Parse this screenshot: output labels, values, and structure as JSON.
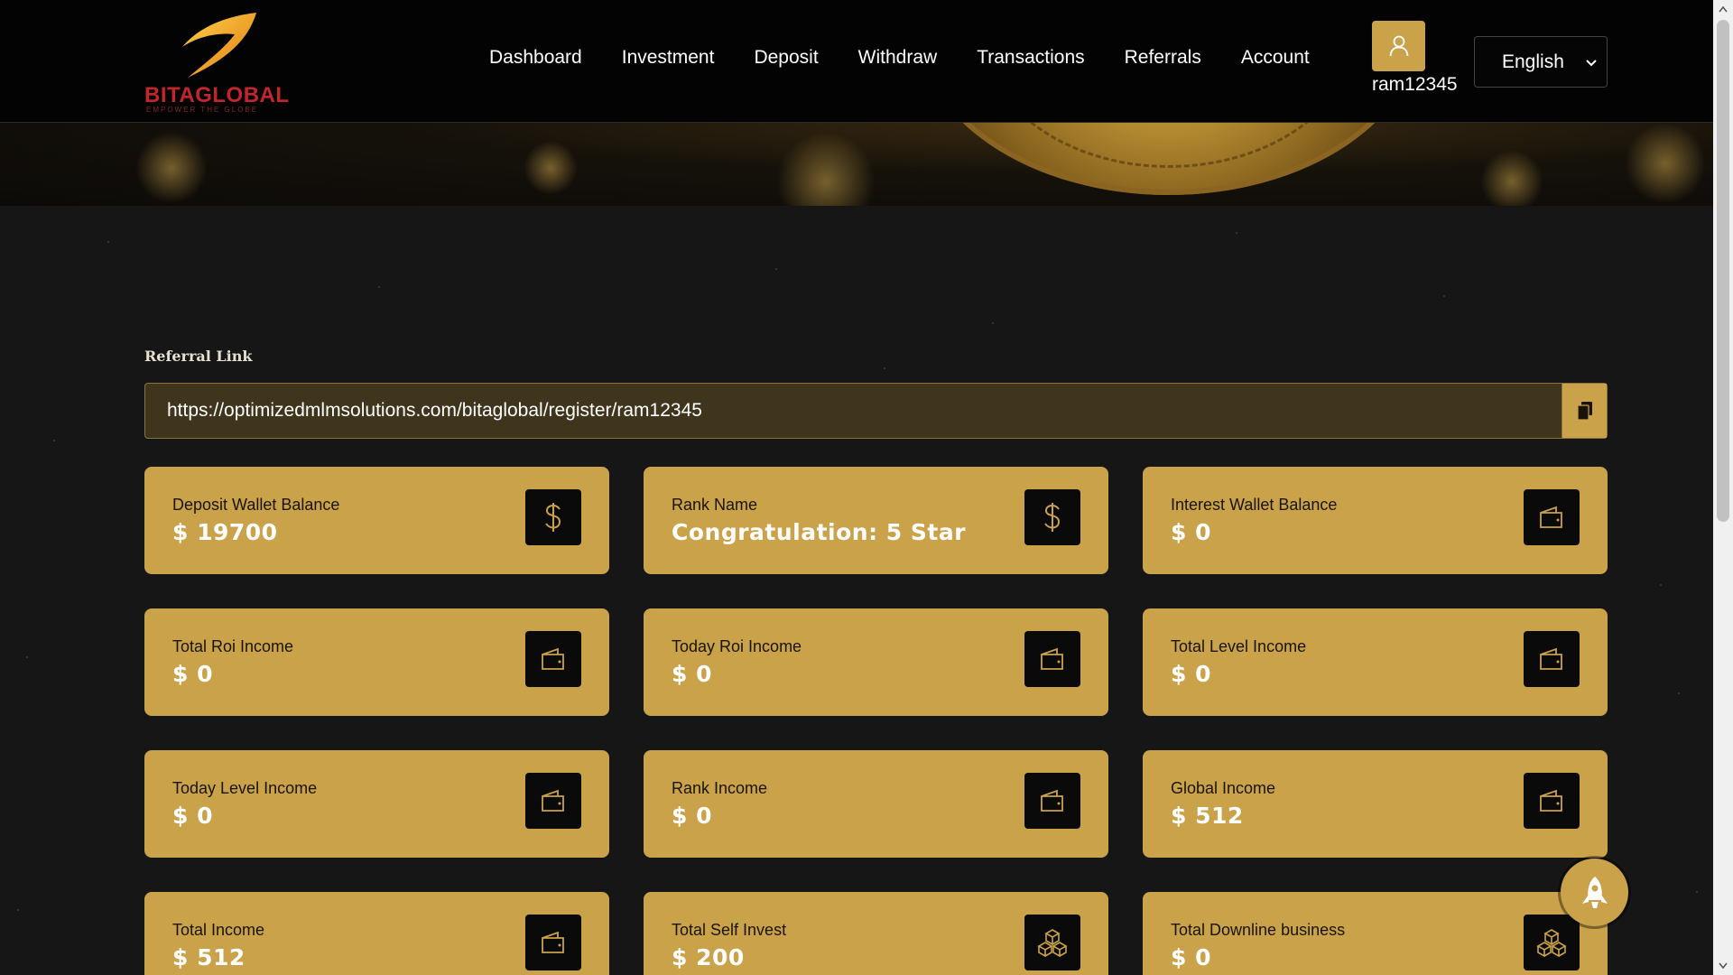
{
  "brand": {
    "name": "BITAGLOBAL",
    "tagline": "EMPOWER THE GLOBE"
  },
  "nav": {
    "items": [
      {
        "label": "Dashboard",
        "name": "nav-dashboard"
      },
      {
        "label": "Investment",
        "name": "nav-investment"
      },
      {
        "label": "Deposit",
        "name": "nav-deposit"
      },
      {
        "label": "Withdraw",
        "name": "nav-withdraw"
      },
      {
        "label": "Transactions",
        "name": "nav-transactions"
      },
      {
        "label": "Referrals",
        "name": "nav-referrals"
      },
      {
        "label": "Account",
        "name": "nav-account"
      }
    ]
  },
  "user": {
    "username": "ram12345",
    "icon": "user-icon"
  },
  "language": {
    "selected": "English"
  },
  "referral": {
    "label": "Referral Link",
    "url": "https://optimizedmlmsolutions.com/bitaglobal/register/ram12345",
    "copy_icon": "copy-icon"
  },
  "cards": [
    {
      "label": "Deposit Wallet Balance",
      "value": "$ 19700",
      "icon": "dollar-icon"
    },
    {
      "label": "Rank Name",
      "value": "Congratulation: 5 Star",
      "icon": "dollar-icon"
    },
    {
      "label": "Interest Wallet Balance",
      "value": "$ 0",
      "icon": "wallet-icon"
    },
    {
      "label": "Total Roi Income",
      "value": "$ 0",
      "icon": "wallet-icon"
    },
    {
      "label": "Today Roi Income",
      "value": "$ 0",
      "icon": "wallet-icon"
    },
    {
      "label": "Total Level Income",
      "value": "$ 0",
      "icon": "wallet-icon"
    },
    {
      "label": "Today Level Income",
      "value": "$ 0",
      "icon": "wallet-icon"
    },
    {
      "label": "Rank Income",
      "value": "$ 0",
      "icon": "wallet-icon"
    },
    {
      "label": "Global Income",
      "value": "$ 512",
      "icon": "wallet-icon"
    },
    {
      "label": "Total Income",
      "value": "$ 512",
      "icon": "wallet-icon"
    },
    {
      "label": "Total Self Invest",
      "value": "$ 200",
      "icon": "cubes-icon"
    },
    {
      "label": "Total Downline business",
      "value": "$ 0",
      "icon": "cubes-icon"
    }
  ],
  "colors": {
    "accent": "#c9a24a",
    "background": "#161616",
    "navbar": "#030303",
    "brand_red": "#c4242b"
  }
}
